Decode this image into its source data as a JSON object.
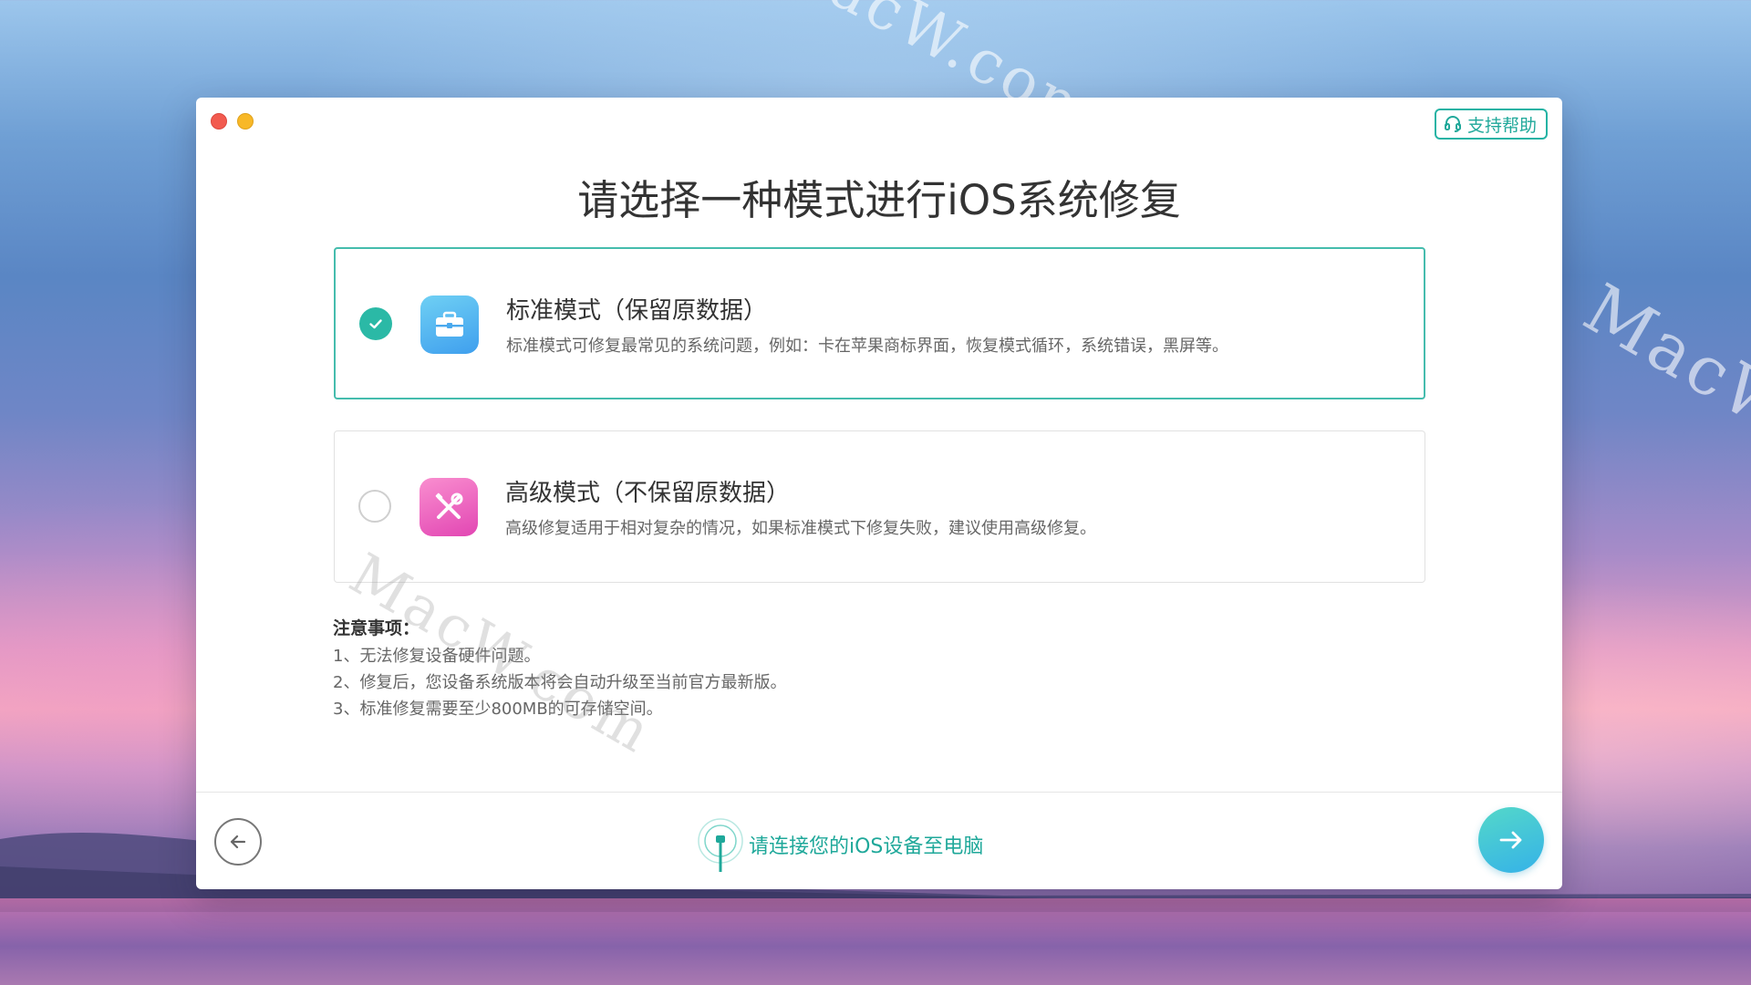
{
  "watermarks": {
    "top": "MacW.com",
    "right": "MacW.co",
    "mid": "MacW.com"
  },
  "window": {
    "traffic_lights": [
      "close",
      "minimize"
    ]
  },
  "header": {
    "support_label": "支持帮助",
    "support_icon": "headset-icon"
  },
  "main": {
    "title": "请选择一种模式进行iOS系统修复",
    "modes": [
      {
        "title": "标准模式（保留原数据）",
        "description": "标准模式可修复最常见的系统问题，例如：卡在苹果商标界面，恢复模式循环，系统错误，黑屏等。",
        "selected": true,
        "icon": "briefcase-icon"
      },
      {
        "title": "高级模式（不保留原数据）",
        "description": "高级修复适用于相对复杂的情况，如果标准模式下修复失败，建议使用高级修复。",
        "selected": false,
        "icon": "tools-icon"
      }
    ]
  },
  "notes": {
    "title": "注意事项：",
    "items": [
      "1、无法修复设备硬件问题。",
      "2、修复后，您设备系统版本将会自动升级至当前官方最新版。",
      "3、标准修复需要至少800MB的可存储空间。"
    ]
  },
  "footer": {
    "connect_text": "请连接您的iOS设备至电脑",
    "back_icon": "arrow-left-icon",
    "next_icon": "arrow-right-icon"
  },
  "colors": {
    "accent": "#25b3a4",
    "next_gradient_start": "#54d8c9",
    "next_gradient_end": "#35b2e8",
    "close": "#f25b4f",
    "minimize": "#f8b827"
  }
}
